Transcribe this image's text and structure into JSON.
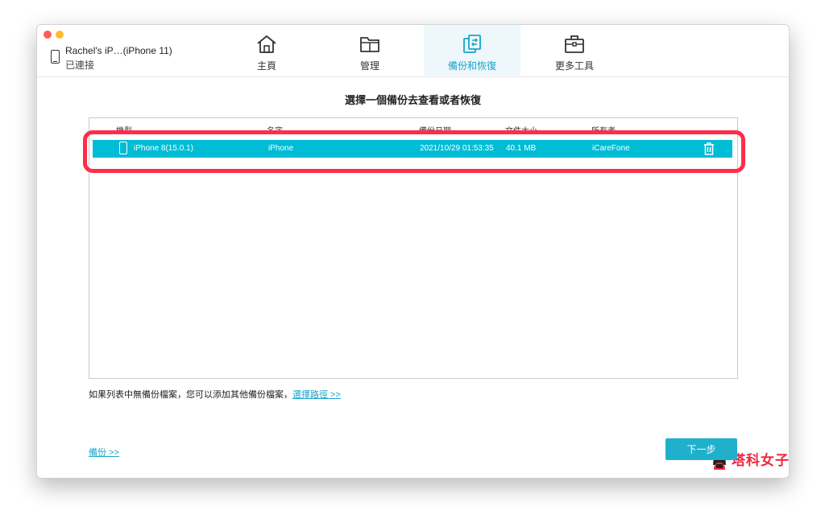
{
  "device": {
    "name": "Rachel's iP…(iPhone 11)",
    "status": "已連接"
  },
  "nav": {
    "tabs": [
      {
        "label": "主頁",
        "icon": "home-icon",
        "active": false
      },
      {
        "label": "管理",
        "icon": "folder-icon",
        "active": false
      },
      {
        "label": "備份和恢復",
        "icon": "backup-restore-icon",
        "active": true
      },
      {
        "label": "更多工具",
        "icon": "toolbox-icon",
        "active": false
      }
    ]
  },
  "main": {
    "heading": "選擇一個備份去查看或者恢復",
    "table": {
      "columns": [
        "機型",
        "名字",
        "備份日期",
        "文件大小",
        "所有者"
      ],
      "rows": [
        {
          "model": "iPhone 8(15.0.1)",
          "name": "iPhone",
          "date": "2021/10/29 01:53:35",
          "size": "40.1 MB",
          "owner": "iCareFone"
        }
      ]
    },
    "watermark": "塔科女子",
    "note": {
      "text": "如果列表中無備份檔案，您可以添加其他備份檔案，",
      "link": "選擇路徑 >>"
    },
    "backup_link": "備份 >>",
    "next_label": "下一步"
  },
  "colors": {
    "accent": "#17a5c9",
    "row_selected": "#00bcd4",
    "highlight": "#ff2d4a",
    "watermark": "#f0273f"
  }
}
